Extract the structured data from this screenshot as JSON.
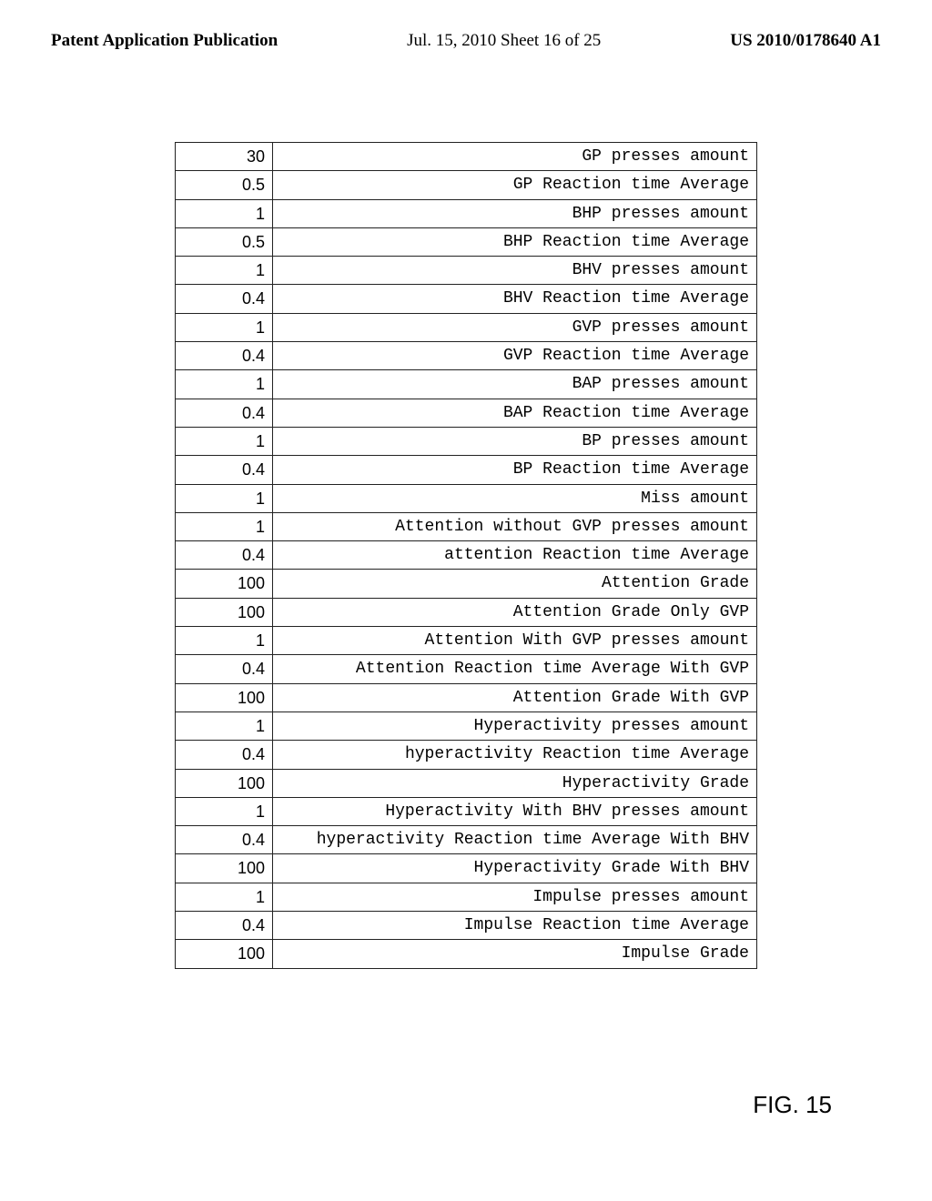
{
  "header": {
    "left": "Patent Application Publication",
    "center": "Jul. 15, 2010  Sheet 16 of 25",
    "right": "US 2010/0178640 A1"
  },
  "rows": [
    {
      "value": "30",
      "label": "GP presses amount"
    },
    {
      "value": "0.5",
      "label": "GP Reaction time Average"
    },
    {
      "value": "1",
      "label": "BHP presses amount"
    },
    {
      "value": "0.5",
      "label": "BHP Reaction time Average"
    },
    {
      "value": "1",
      "label": "BHV presses amount"
    },
    {
      "value": "0.4",
      "label": "BHV Reaction time Average"
    },
    {
      "value": "1",
      "label": "GVP presses amount"
    },
    {
      "value": "0.4",
      "label": "GVP Reaction time Average"
    },
    {
      "value": "1",
      "label": "BAP presses amount"
    },
    {
      "value": "0.4",
      "label": "BAP Reaction time Average"
    },
    {
      "value": "1",
      "label": "BP presses amount"
    },
    {
      "value": "0.4",
      "label": "BP Reaction time Average"
    },
    {
      "value": "1",
      "label": "Miss amount"
    },
    {
      "value": "1",
      "label": "Attention without GVP presses amount"
    },
    {
      "value": "0.4",
      "label": "attention Reaction time Average"
    },
    {
      "value": "100",
      "label": "Attention Grade"
    },
    {
      "value": "100",
      "label": "Attention Grade Only GVP"
    },
    {
      "value": "1",
      "label": "Attention With GVP presses amount"
    },
    {
      "value": "0.4",
      "label": "Attention Reaction time Average With GVP"
    },
    {
      "value": "100",
      "label": "Attention Grade With GVP"
    },
    {
      "value": "1",
      "label": "Hyperactivity presses amount"
    },
    {
      "value": "0.4",
      "label": "hyperactivity Reaction time Average"
    },
    {
      "value": "100",
      "label": "Hyperactivity Grade"
    },
    {
      "value": "1",
      "label": "Hyperactivity With BHV presses amount"
    },
    {
      "value": "0.4",
      "label": "hyperactivity Reaction time Average With BHV"
    },
    {
      "value": "100",
      "label": "Hyperactivity Grade With BHV"
    },
    {
      "value": "1",
      "label": "Impulse presses amount"
    },
    {
      "value": "0.4",
      "label": "Impulse Reaction time Average"
    },
    {
      "value": "100",
      "label": "Impulse Grade"
    }
  ],
  "figure_label": "FIG. 15"
}
